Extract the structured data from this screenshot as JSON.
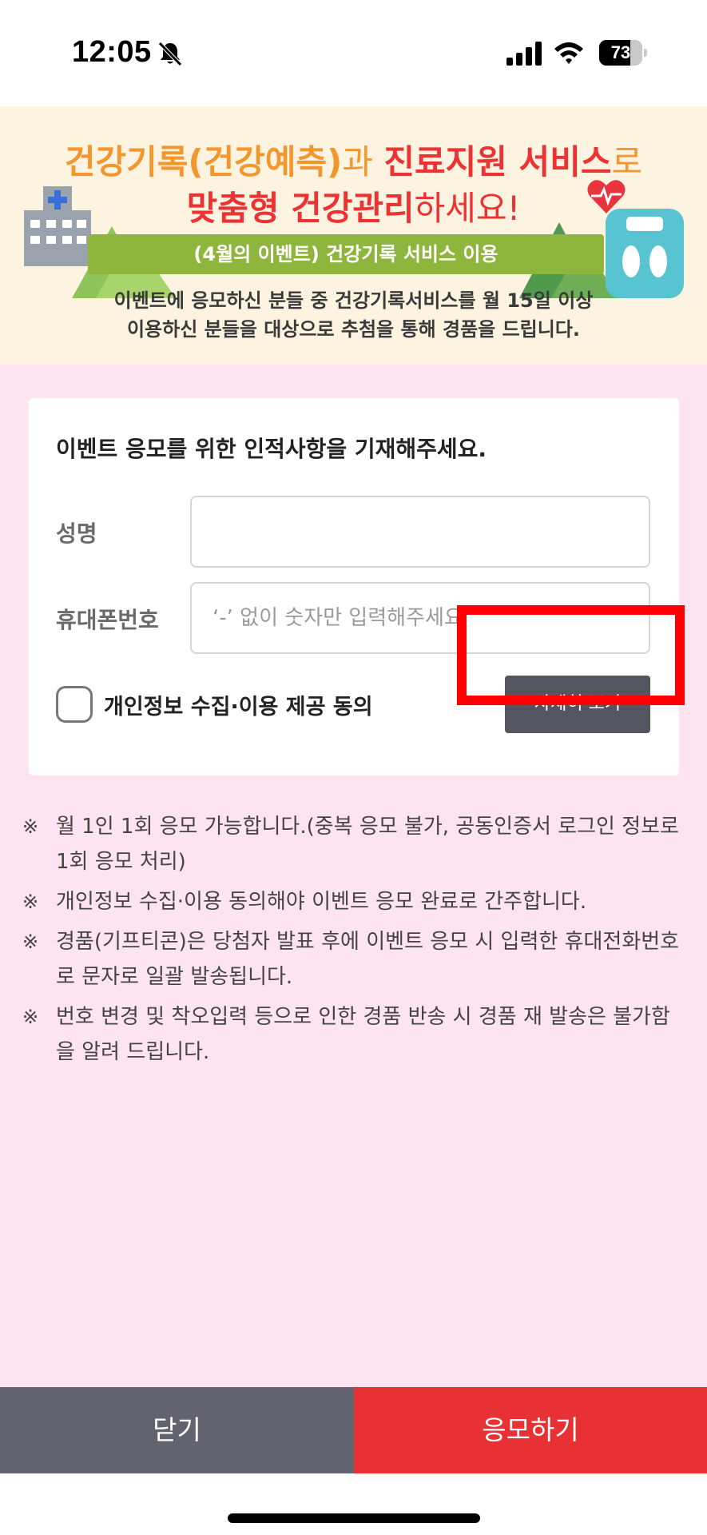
{
  "status_bar": {
    "time": "12:05",
    "battery_level": "73",
    "battery_fraction": 0.73,
    "icons": [
      "bell-slash-icon",
      "cellular-signal-icon",
      "wifi-icon",
      "battery-icon"
    ]
  },
  "banner": {
    "line1_part1": "건강기록(건강예측)",
    "line1_part2": "과 ",
    "line1_part3": "진료지원 서비스",
    "line1_part4": "로",
    "line2_part1": "맞춤형 건강관리",
    "line2_part2": "하세요!",
    "ribbon": "(4월의 이벤트) 건강기록 서비스 이용",
    "desc_line1": "이벤트에 응모하신 분들 중 건강기록서비스를 월 15일 이상",
    "desc_line2": "이용하신 분들을 대상으로 추첨을 통해 경품을 드립니다.",
    "colors": {
      "background": "#fdf3e1",
      "orange": "#f2962e",
      "red": "#ec3232",
      "green": "#8fb63c"
    }
  },
  "form": {
    "title": "이벤트 응모를 위한 인적사항을 기재해주세요.",
    "name_label": "성명",
    "name_value": "",
    "phone_label": "휴대폰번호",
    "phone_placeholder": "‘-’ 없이 숫자만 입력해주세요",
    "phone_value": "",
    "agree_label": "개인정보 수집·이용 제공 동의",
    "agree_checked": false,
    "detail_button": "자세히 보기"
  },
  "notes": [
    {
      "mark": "※",
      "text": "월 1인 1회 응모 가능합니다.(중복 응모 불가, 공동인증서 로그인 정보로 1회 응모 처리)"
    },
    {
      "mark": "※",
      "text": "개인정보 수집·이용 동의해야 이벤트 응모 완료로 간주합니다."
    },
    {
      "mark": "※",
      "text": "경품(기프티콘)은 당첨자 발표 후에 이벤트 응모 시 입력한 휴대전화번호로 문자로 일괄 발송됩니다."
    },
    {
      "mark": "※",
      "text": "번호 변경 및 착오입력 등으로 인한 경품 반송 시 경품 재 발송은 불가함을 알려 드립니다."
    }
  ],
  "bottom": {
    "close": "닫기",
    "apply": "응모하기",
    "colors": {
      "close": "#636370",
      "apply": "#e83134"
    }
  },
  "page_background": "#fde4f0",
  "highlight_color": "#ff0000"
}
